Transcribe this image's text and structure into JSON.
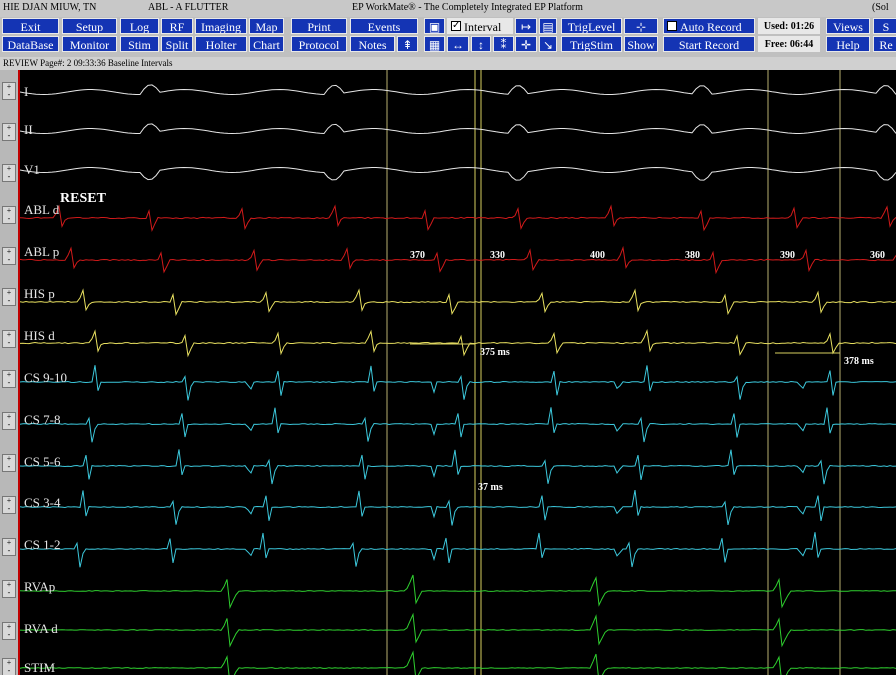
{
  "titlebar": {
    "patient": "HIE DJAN MIUW, TN",
    "procedure": "ABL - A FLUTTER",
    "product": "EP WorkMate® - The Completely Integrated EP Platform",
    "right_cut": "(Sol"
  },
  "toolbar": {
    "row1": [
      "Exit",
      "Setup",
      "Log",
      "RF",
      "Imaging",
      "Map",
      "Print",
      "Events"
    ],
    "row2": [
      "DataBase",
      "Monitor",
      "Stim",
      "Split",
      "Holter",
      "Chart",
      "Protocol",
      "Notes"
    ],
    "interval_label": "Interval",
    "trig_level": "TrigLevel",
    "trig_stim": "TrigStim",
    "show": "Show",
    "auto_record": "Auto Record",
    "start_record": "Start Record",
    "used": "Used: 01:26",
    "free": "Free: 06:44",
    "views": "Views",
    "help": "Help",
    "right1": "S",
    "right2": "Re"
  },
  "status": {
    "text": "REVIEW Page#: 2   09:33:36   Baseline Intervals"
  },
  "channels": [
    {
      "name": "I",
      "color": "#e6e6e6"
    },
    {
      "name": "II",
      "color": "#e6e6e6"
    },
    {
      "name": "V1",
      "color": "#e6e6e6"
    },
    {
      "name": "ABL d",
      "color": "#d11a1a"
    },
    {
      "name": "ABL p",
      "color": "#d11a1a"
    },
    {
      "name": "HIS p",
      "color": "#e8e060"
    },
    {
      "name": "HIS d",
      "color": "#e8e060"
    },
    {
      "name": "CS 9-10",
      "color": "#3cc8dc"
    },
    {
      "name": "CS 7-8",
      "color": "#3cc8dc"
    },
    {
      "name": "CS 5-6",
      "color": "#3cc8dc"
    },
    {
      "name": "CS 3-4",
      "color": "#3cc8dc"
    },
    {
      "name": "CS 1-2",
      "color": "#3cc8dc"
    },
    {
      "name": "RVAp",
      "color": "#2fd02f"
    },
    {
      "name": "RVA d",
      "color": "#2fd02f"
    },
    {
      "name": "STIM",
      "color": "#2fd02f"
    }
  ],
  "annotations": {
    "reset": "RESET",
    "intervals": [
      "370",
      "330",
      "400",
      "380",
      "390",
      "360"
    ],
    "his_interval_1": "375 ms",
    "his_interval_2": "378 ms",
    "cs_interval": "37 ms"
  },
  "colors": {
    "toolbar_button": "#1434b4",
    "toolbar_bg": "#c0c0c0",
    "cursor": "#d8d060"
  }
}
